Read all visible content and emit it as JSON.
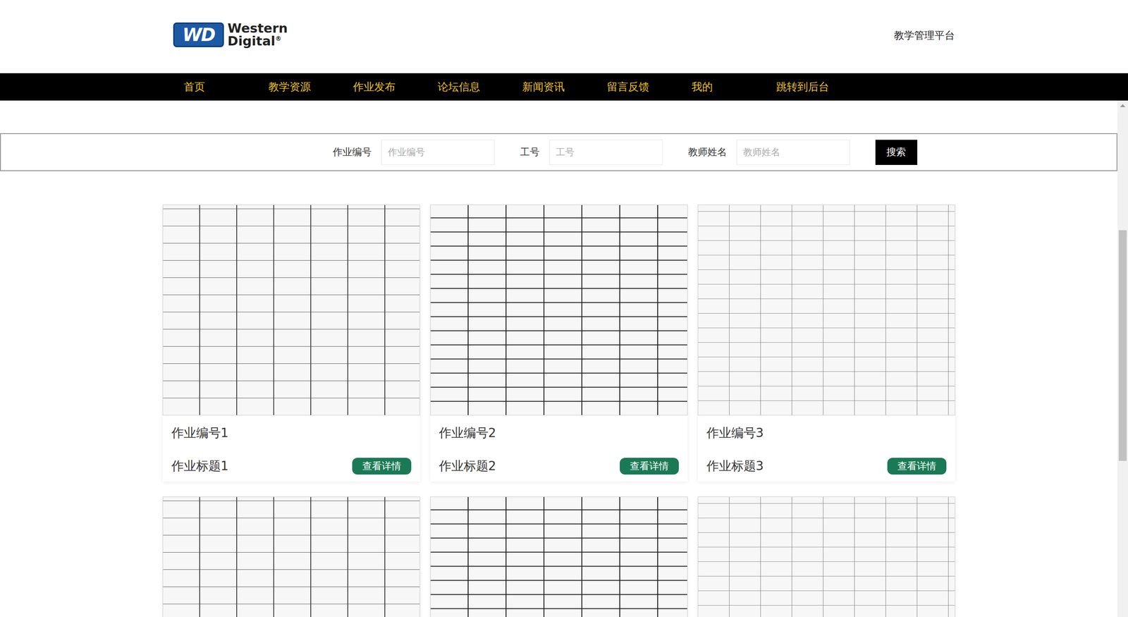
{
  "header": {
    "logo": {
      "mark": "WD",
      "line1": "Western",
      "line2": "Digital",
      "registered": "®"
    },
    "platform": "教学管理平台"
  },
  "nav": [
    {
      "label": "首页"
    },
    {
      "label": "教学资源"
    },
    {
      "label": "作业发布"
    },
    {
      "label": "论坛信息"
    },
    {
      "label": "新闻资讯"
    },
    {
      "label": "留言反馈"
    },
    {
      "label": "我的"
    },
    {
      "label": "跳转到后台"
    }
  ],
  "search": {
    "fields": [
      {
        "label": "作业编号",
        "placeholder": "作业编号"
      },
      {
        "label": "工号",
        "placeholder": "工号"
      },
      {
        "label": "教师姓名",
        "placeholder": "教师姓名"
      }
    ],
    "button": "搜索"
  },
  "cards": [
    {
      "number": "作业编号1",
      "title": "作业标题1",
      "button": "查看详情"
    },
    {
      "number": "作业编号2",
      "title": "作业标题2",
      "button": "查看详情"
    },
    {
      "number": "作业编号3",
      "title": "作业标题3",
      "button": "查看详情"
    },
    {},
    {},
    {}
  ]
}
